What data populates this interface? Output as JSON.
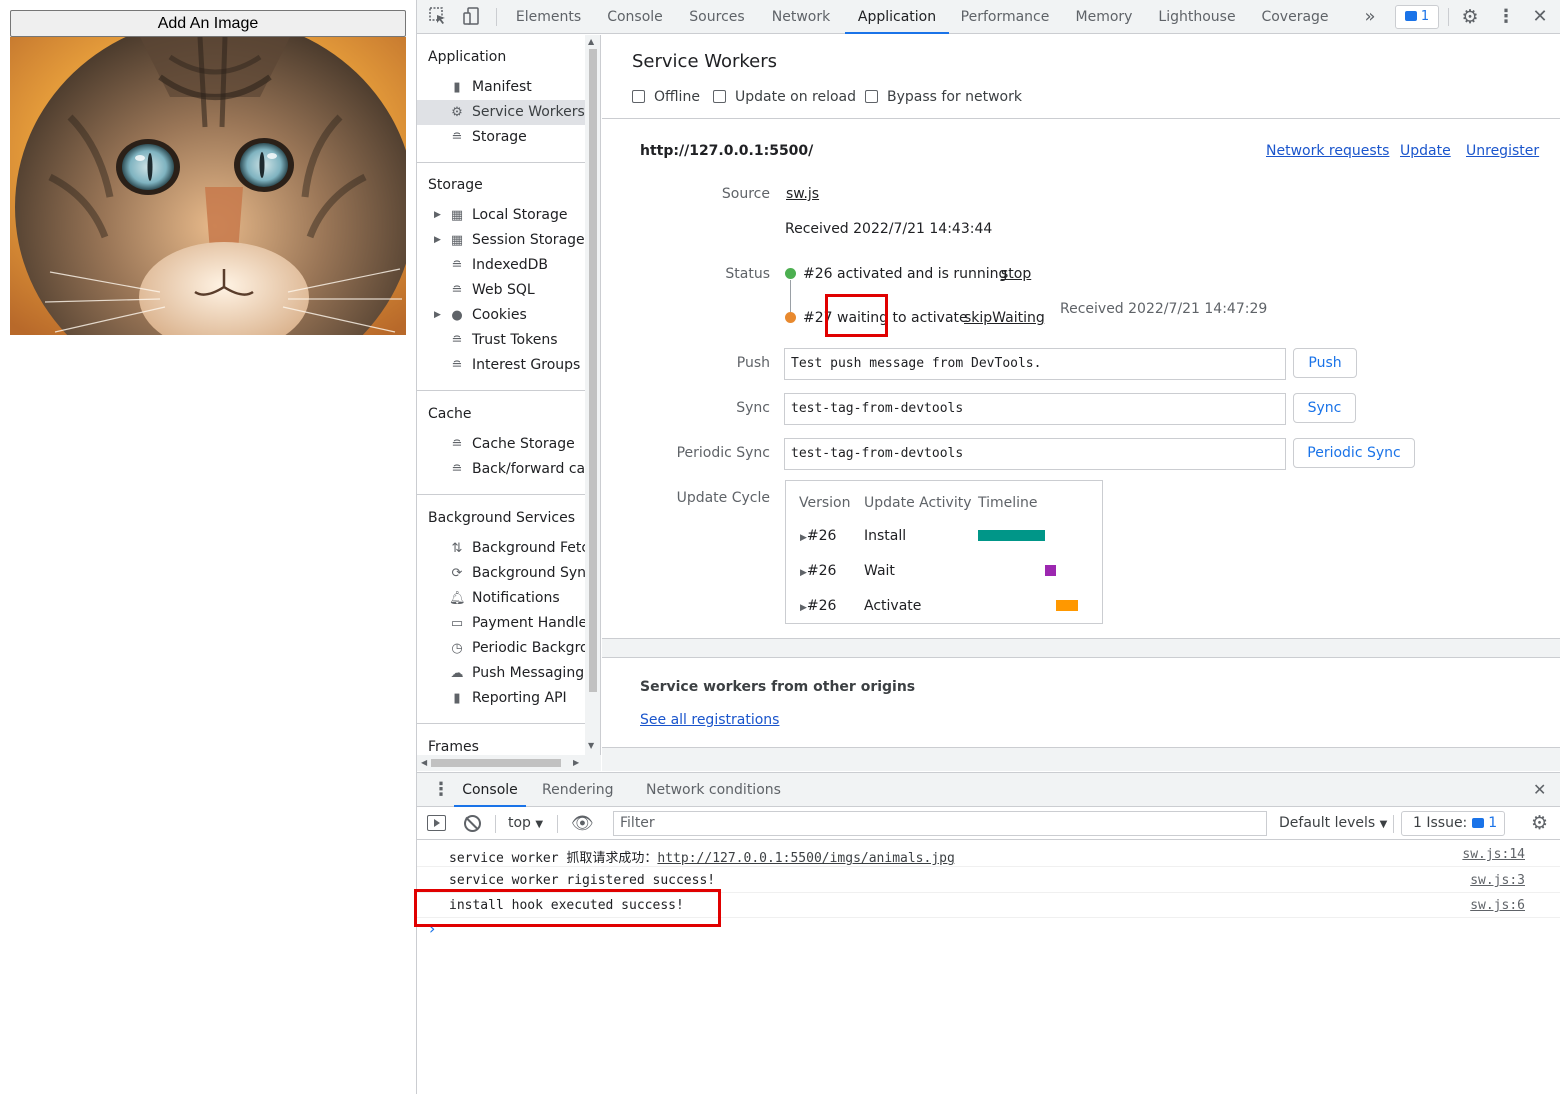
{
  "page": {
    "add_button_label": "Add An Image"
  },
  "devtools": {
    "tabs": [
      "Elements",
      "Console",
      "Sources",
      "Network",
      "Application",
      "Performance",
      "Memory",
      "Lighthouse",
      "Coverage"
    ],
    "active_tab": "Application",
    "issues_count": "1",
    "sidebar": {
      "application_title": "Application",
      "application_items": [
        "Manifest",
        "Service Workers",
        "Storage"
      ],
      "storage_title": "Storage",
      "storage_items": [
        "Local Storage",
        "Session Storage",
        "IndexedDB",
        "Web SQL",
        "Cookies",
        "Trust Tokens",
        "Interest Groups"
      ],
      "cache_title": "Cache",
      "cache_items": [
        "Cache Storage",
        "Back/forward cac"
      ],
      "bg_title": "Background Services",
      "bg_items": [
        "Background Fetch",
        "Background Sync",
        "Notifications",
        "Payment Handler",
        "Periodic Background Sync",
        "Push Messaging",
        "Reporting API"
      ],
      "frames_title": "Frames"
    },
    "service_workers": {
      "title": "Service Workers",
      "options": [
        "Offline",
        "Update on reload",
        "Bypass for network"
      ],
      "origin": "http://127.0.0.1:5500/",
      "origin_links": [
        "Network requests",
        "Update",
        "Unregister"
      ],
      "source_label": "Source",
      "source_file": "sw.js",
      "received_1": "Received 2022/7/21 14:43:44",
      "status_label": "Status",
      "status_active": "#26 activated and is running",
      "stop_link": "stop",
      "status_waiting_num": "#27",
      "status_waiting_word": "waiting",
      "status_waiting_rest": "to activate",
      "skip_waiting_link": "skipWaiting",
      "received_2": "Received 2022/7/21 14:47:29",
      "push_label": "Push",
      "push_value": "Test push message from DevTools.",
      "push_button": "Push",
      "sync_label": "Sync",
      "sync_value": "test-tag-from-devtools",
      "sync_button": "Sync",
      "periodic_label": "Periodic Sync",
      "periodic_value": "test-tag-from-devtools",
      "periodic_button": "Periodic Sync",
      "update_cycle_label": "Update Cycle",
      "update_cycle": {
        "headers": [
          "Version",
          "Update Activity",
          "Timeline"
        ],
        "rows": [
          {
            "version": "#26",
            "activity": "Install",
            "color": "#009688"
          },
          {
            "version": "#26",
            "activity": "Wait",
            "color": "#9c27b0"
          },
          {
            "version": "#26",
            "activity": "Activate",
            "color": "#ff9800"
          }
        ]
      },
      "other_origins_title": "Service workers from other origins",
      "see_all_link": "See all registrations"
    },
    "drawer": {
      "tabs": [
        "Console",
        "Rendering",
        "Network conditions"
      ],
      "context": "top",
      "filter_placeholder": "Filter",
      "levels": "Default levels",
      "issues": "1 Issue:",
      "issues_count": "1",
      "messages": [
        {
          "text_prefix": "service worker 抓取请求成功：",
          "link": "http://127.0.0.1:5500/imgs/animals.jpg",
          "source": "sw.js:14"
        },
        {
          "text_prefix": "service worker rigistered success!",
          "link": "",
          "source": "sw.js:3"
        },
        {
          "text_prefix": "install hook executed success!",
          "link": "",
          "source": "sw.js:6"
        }
      ],
      "prompt": "›"
    }
  }
}
